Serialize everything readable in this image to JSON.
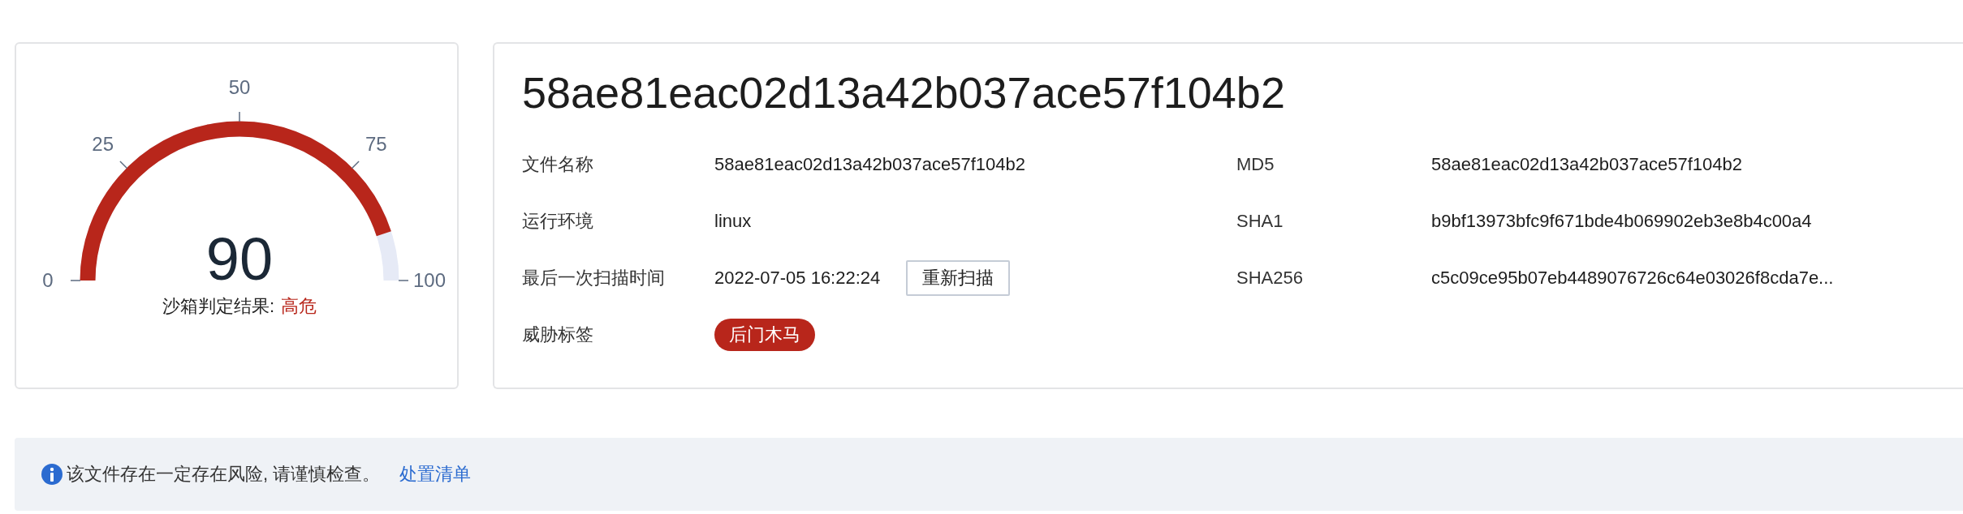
{
  "gauge": {
    "value": "90",
    "ticks": [
      "0",
      "25",
      "50",
      "75",
      "100"
    ],
    "label": "沙箱判定结果:",
    "verdict": "高危"
  },
  "file": {
    "title": "58ae81eac02d13a42b037ace57f104b2",
    "details": [
      {
        "kind": "text",
        "label": "文件名称",
        "value": "58ae81eac02d13a42b037ace57f104b2"
      },
      {
        "kind": "text",
        "label": "运行环境",
        "value": "linux"
      },
      {
        "kind": "action",
        "label": "最后一次扫描时间",
        "value": "2022-07-05 16:22:24",
        "button": "重新扫描"
      },
      {
        "kind": "tag",
        "label": "威胁标签",
        "value": "后门木马"
      }
    ],
    "hashes": [
      {
        "label": "MD5",
        "value": "58ae81eac02d13a42b037ace57f104b2"
      },
      {
        "label": "SHA1",
        "value": "b9bf13973bfc9f671bde4b069902eb3e8b4c00a4"
      },
      {
        "label": "SHA256",
        "value": "c5c09ce95b07eb4489076726c64e03026f8cda7e..."
      }
    ]
  },
  "notice": {
    "text": "该文件存在一定存在风险, 请谨慎检查。",
    "link": "处置清单"
  }
}
